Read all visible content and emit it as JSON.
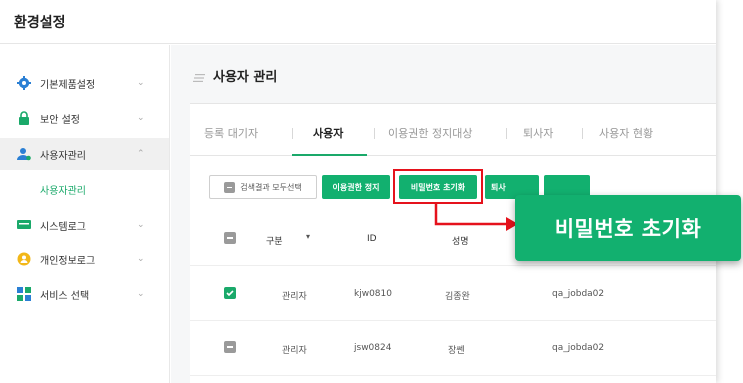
{
  "app": {
    "title": "환경설정"
  },
  "sidebar": {
    "items": [
      {
        "label": "기본제품설정",
        "icon": "gear-icon",
        "chevron": "⌄"
      },
      {
        "label": "보안 설정",
        "icon": "lock-icon",
        "chevron": "⌄"
      },
      {
        "label": "사용자관리",
        "icon": "user-icon",
        "chevron": "⌃"
      },
      {
        "label": "시스템로그",
        "icon": "monitor-icon",
        "chevron": "⌄"
      },
      {
        "label": "개인정보로그",
        "icon": "person-circle-icon",
        "chevron": "⌄"
      },
      {
        "label": "서비스 선택",
        "icon": "grid-icon",
        "chevron": "⌄"
      }
    ],
    "sub_item": "사용자관리"
  },
  "page": {
    "title": "사용자 관리"
  },
  "tabs": [
    {
      "label": "등록 대기자",
      "active": false
    },
    {
      "label": "사용자",
      "active": true
    },
    {
      "label": "이용권한 정지대상",
      "active": false
    },
    {
      "label": "퇴사자",
      "active": false
    },
    {
      "label": "사용자 현황",
      "active": false
    }
  ],
  "toolbar": {
    "select_all": "검색결과 모두선택",
    "suspend": "이용권한 정지",
    "reset_password": "비밀번호 초기화",
    "retire": "퇴사"
  },
  "table": {
    "headers": {
      "type": "구분",
      "id": "ID",
      "name": "성명"
    },
    "rows": [
      {
        "checked": true,
        "type": "관리자",
        "id": "kjw0810",
        "name": "김종완",
        "group": "qa_jobda02"
      },
      {
        "checked": false,
        "type": "관리자",
        "id": "jsw0824",
        "name": "장쎈",
        "group": "qa_jobda02"
      }
    ]
  },
  "callout": {
    "text": "비밀번호 초기화"
  },
  "colors": {
    "accent": "#12b06f",
    "highlight": "#e5121c"
  }
}
